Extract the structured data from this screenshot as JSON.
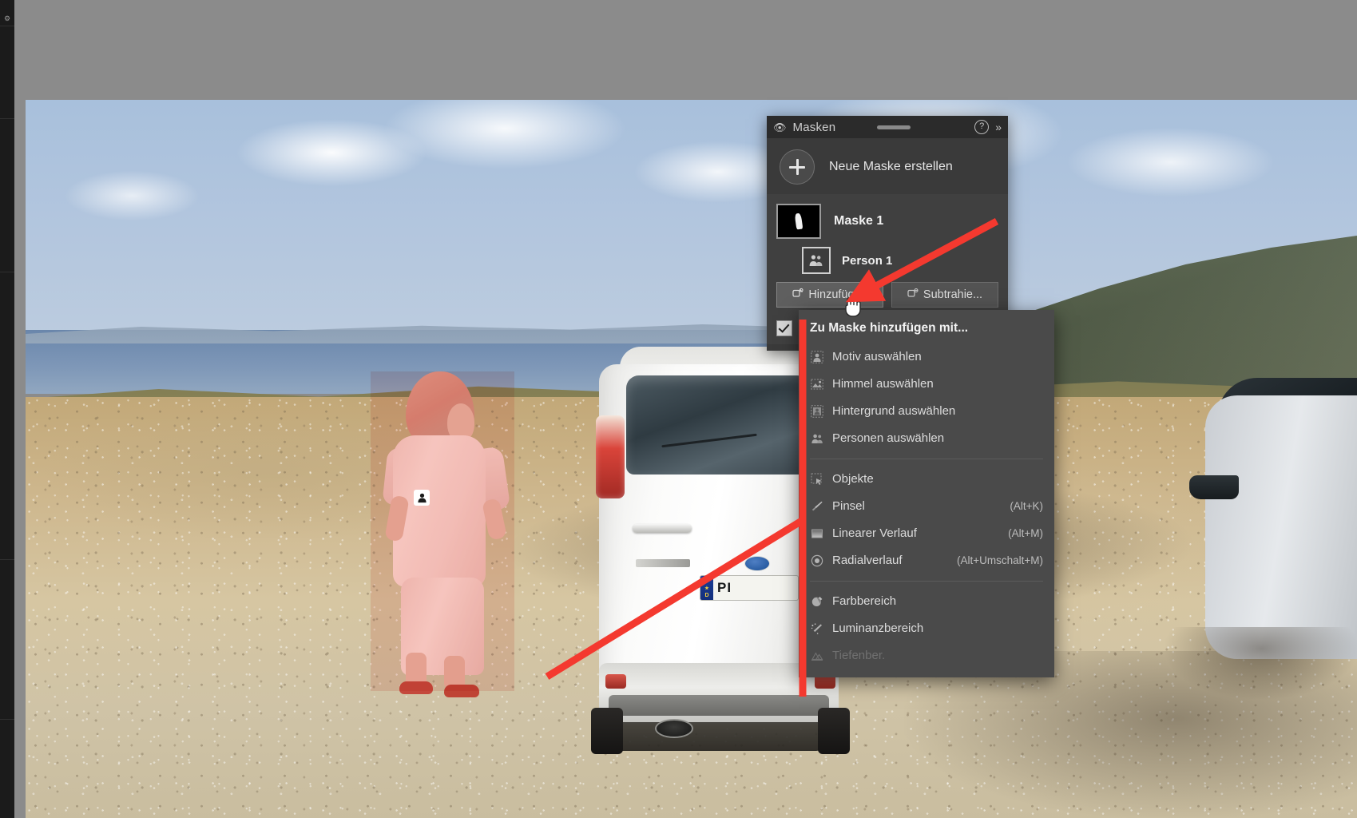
{
  "application": {
    "panel_title": "Masken"
  },
  "panel": {
    "title": "Masken",
    "eye_icon": "eye-icon",
    "help_icon": "question-mark-icon",
    "collapse_icon": "double-chevron-right-icon",
    "new_mask_label": "Neue Maske erstellen",
    "masks": [
      {
        "name": "Maske 1",
        "thumbnail": "black-mask-with-person-silhouette",
        "children": [
          {
            "name": "Person 1",
            "icon": "people-icon"
          }
        ]
      }
    ],
    "buttons": [
      {
        "label": "Hinzufügen",
        "icon": "add-mask-icon",
        "state": "hovered"
      },
      {
        "label": "Subtrahie...",
        "icon": "subtract-mask-icon",
        "state": "normal"
      }
    ],
    "invert_checkbox": {
      "checked": true
    }
  },
  "menu": {
    "header": "Zu Maske hinzufügen mit...",
    "groups": [
      {
        "items": [
          {
            "label": "Motiv auswählen",
            "icon": "subject-icon",
            "shortcut": "",
            "disabled": false
          },
          {
            "label": "Himmel auswählen",
            "icon": "sky-icon",
            "shortcut": "",
            "disabled": false
          },
          {
            "label": "Hintergrund auswählen",
            "icon": "background-icon",
            "shortcut": "",
            "disabled": false
          },
          {
            "label": "Personen auswählen",
            "icon": "people-icon",
            "shortcut": "",
            "disabled": false
          }
        ]
      },
      {
        "items": [
          {
            "label": "Objekte",
            "icon": "objects-select-icon",
            "shortcut": "",
            "disabled": false
          },
          {
            "label": "Pinsel",
            "icon": "brush-icon",
            "shortcut": "(Alt+K)",
            "disabled": false
          },
          {
            "label": "Linearer Verlauf",
            "icon": "linear-gradient-icon",
            "shortcut": "(Alt+M)",
            "disabled": false
          },
          {
            "label": "Radialverlauf",
            "icon": "radial-gradient-icon",
            "shortcut": "(Alt+Umschalt+M)",
            "disabled": false
          }
        ]
      },
      {
        "items": [
          {
            "label": "Farbbereich",
            "icon": "color-range-icon",
            "shortcut": "",
            "disabled": false
          },
          {
            "label": "Luminanzbereich",
            "icon": "luminance-range-icon",
            "shortcut": "",
            "disabled": false
          },
          {
            "label": "Tiefenber.",
            "icon": "depth-range-icon",
            "shortcut": "",
            "disabled": true
          }
        ]
      }
    ]
  },
  "photo": {
    "description": "Frau in rosa Kleidung vor weißem SUV an Küstenstraße",
    "license_plate": {
      "country_code": "D",
      "characters": "PI"
    },
    "person_mask_badge": "person-mask-badge-icon"
  },
  "colors": {
    "annotation": "#f4392f",
    "panel_background": "#3a3a3a",
    "panel_titlebar": "#2b2b2b",
    "menu_background": "#4a4a4a",
    "canvas_background": "#8b8b8b",
    "mask_overlay": "#ec786e"
  }
}
